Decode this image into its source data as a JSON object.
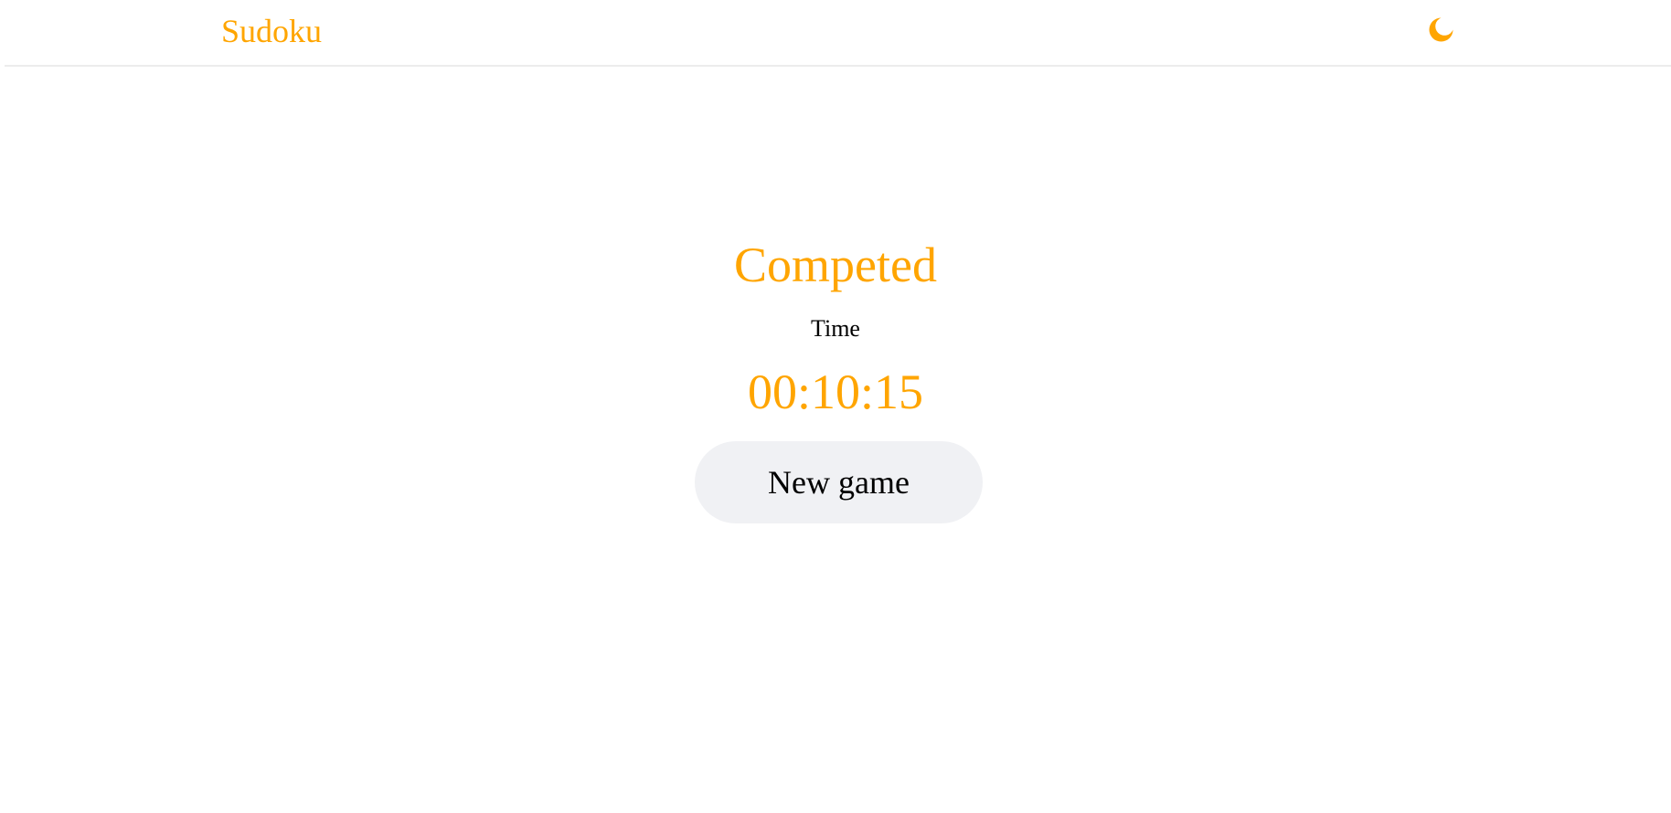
{
  "header": {
    "brand": "Sudoku",
    "theme_toggle_icon": "moon-icon",
    "accent_color": "#ffa500"
  },
  "result": {
    "title": "Competed",
    "time_label": "Time",
    "time_value": "00:10:15",
    "new_game_label": "New game"
  },
  "colors": {
    "accent": "#ffa500",
    "button_background": "#f0f1f4",
    "text": "#000000",
    "background": "#ffffff"
  }
}
